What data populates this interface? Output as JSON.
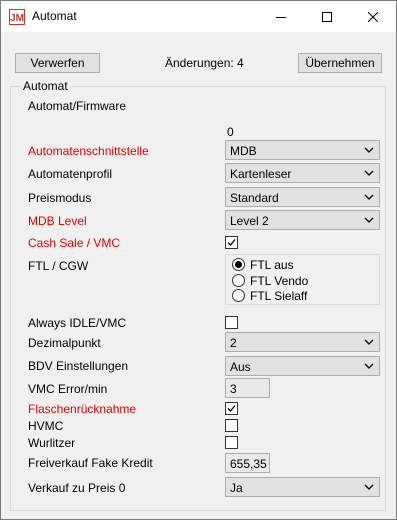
{
  "window": {
    "title": "Automat",
    "icon": "app-logo-icon"
  },
  "toolbar": {
    "discard_label": "Verwerfen",
    "changes_text": "Änderungen: 4",
    "apply_label": "Übernehmen"
  },
  "group": {
    "title": "Automat",
    "firmware_label": "Automat/Firmware",
    "firmware_value": "0"
  },
  "fields": {
    "interface": {
      "label": "Automatenschnittstelle",
      "value": "MDB"
    },
    "profile": {
      "label": "Automatenprofil",
      "value": "Kartenleser"
    },
    "pricemode": {
      "label": "Preismodus",
      "value": "Standard"
    },
    "mdblevel": {
      "label": "MDB Level",
      "value": "Level 2"
    },
    "cashsale": {
      "label": "Cash Sale / VMC",
      "checked": true
    },
    "ftl": {
      "label": "FTL / CGW",
      "options": [
        "FTL aus",
        "FTL Vendo",
        "FTL Sielaff"
      ],
      "selected": "FTL aus"
    },
    "alwaysidle": {
      "label": "Always IDLE/VMC",
      "checked": false
    },
    "decimal": {
      "label": "Dezimalpunkt",
      "value": "2"
    },
    "bdv": {
      "label": "BDV Einstellungen",
      "value": "Aus"
    },
    "vmcerror": {
      "label": "VMC Error/min",
      "value": "3"
    },
    "bottlereturn": {
      "label": "Flaschenrücknahme",
      "checked": true
    },
    "hvmc": {
      "label": "HVMC",
      "checked": false
    },
    "wurlitzer": {
      "label": "Wurlitzer",
      "checked": false
    },
    "freevend": {
      "label": "Freiverkauf Fake Kredit",
      "value": "655,35"
    },
    "sellzero": {
      "label": "Verkauf zu Preis 0",
      "value": "Ja"
    }
  },
  "colors": {
    "required_label": "#e00000",
    "titlebar": "#ffffff",
    "background": "#f0f0f0"
  }
}
